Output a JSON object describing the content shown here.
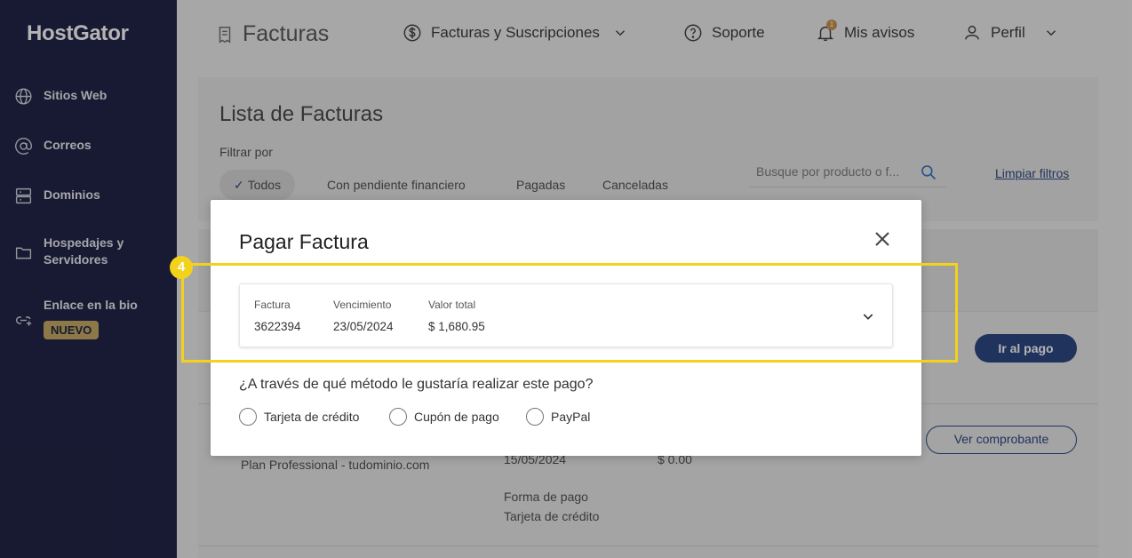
{
  "sidebar": {
    "logo": "HostGator",
    "items": [
      {
        "label": "Sitios Web",
        "icon": "globe-icon"
      },
      {
        "label": "Correos",
        "icon": "at-icon"
      },
      {
        "label": "Dominios",
        "icon": "server-icon"
      },
      {
        "label": "Hospedajes y Servidores",
        "icon": "folder-icon"
      },
      {
        "label": "Enlace en la bio",
        "icon": "link-add-icon",
        "badge": "NUEVO"
      }
    ]
  },
  "header": {
    "title": "Facturas",
    "billing_menu": "Facturas y Suscripciones",
    "support": "Soporte",
    "notifications": "Mis avisos",
    "notification_count": "1",
    "profile": "Perfil"
  },
  "main": {
    "list_title": "Lista de Facturas",
    "filter_label": "Filtrar por",
    "filters": [
      "Todos",
      "Con pendiente financiero",
      "Pagadas",
      "Canceladas"
    ],
    "active_filter": "Todos",
    "search_placeholder": "Busque por producto o f...",
    "clear_filters": "Limpiar filtros",
    "pay_button": "Ir al pago",
    "receipt_button": "Ver comprobante",
    "row": {
      "product": "Plan Professional - tudominio.com",
      "date": "15/05/2024",
      "amount": "$ 0.00",
      "payment_method_label": "Forma de pago",
      "payment_method": "Tarjeta de crédito"
    }
  },
  "modal": {
    "title": "Pagar Factura",
    "invoice_label": "Factura",
    "invoice_value": "3622394",
    "due_label": "Vencimiento",
    "due_value": "23/05/2024",
    "total_label": "Valor total",
    "total_value": "$ 1,680.95",
    "question": "¿A través de qué método le gustaría realizar este pago?",
    "methods": [
      "Tarjeta de crédito",
      "Cupón de pago",
      "PayPal"
    ]
  },
  "tutorial": {
    "step": "4",
    "highlight_color": "#f2d21b"
  },
  "colors": {
    "sidebar_bg": "#0f1338",
    "primary": "#1c3a7a",
    "badge": "#c4a35a"
  }
}
